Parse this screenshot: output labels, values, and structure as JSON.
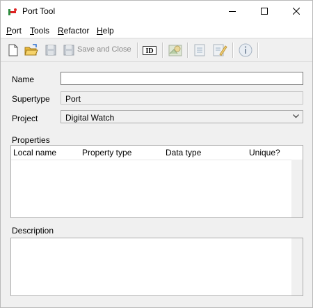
{
  "window": {
    "title": "Port Tool",
    "accent": "#4a7ebb"
  },
  "menu": [
    {
      "label_acc": "P",
      "label_rest": "ort"
    },
    {
      "label_acc": "T",
      "label_rest": "ools"
    },
    {
      "label_acc": "R",
      "label_rest": "efactor"
    },
    {
      "label_acc": "H",
      "label_rest": "elp"
    }
  ],
  "toolbar": {
    "save_close_label": "Save and Close",
    "id_label": "ID",
    "icons": [
      "new-document-icon",
      "open-folder-icon",
      "save-icon",
      "save-close-icon",
      "id-icon",
      "map-icon",
      "list-icon",
      "edit-icon",
      "info-icon"
    ]
  },
  "form": {
    "name_label": "Name",
    "name_value": "",
    "supertype_label": "Supertype",
    "supertype_value": "Port",
    "project_label": "Project",
    "project_value": "Digital Watch"
  },
  "properties": {
    "label": "Properties",
    "columns": [
      "Local name",
      "Property type",
      "Data type",
      "Unique?"
    ],
    "rows": []
  },
  "description": {
    "label": "Description",
    "value": ""
  }
}
